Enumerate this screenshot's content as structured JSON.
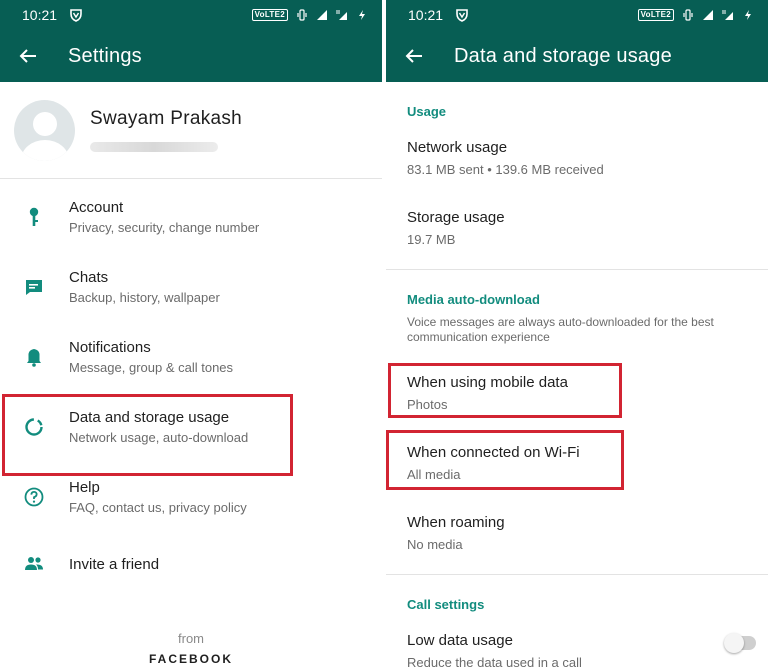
{
  "colors": {
    "brand": "#075e54",
    "accent": "#128c7e",
    "highlight": "#d22432"
  },
  "status_bar": {
    "time": "10:21",
    "volte_label": "VoLTE2"
  },
  "left": {
    "title": "Settings",
    "profile": {
      "name": "Swayam Prakash"
    },
    "items": [
      {
        "title": "Account",
        "subtitle": "Privacy, security, change number",
        "icon": "key-icon"
      },
      {
        "title": "Chats",
        "subtitle": "Backup, history, wallpaper",
        "icon": "chat-icon"
      },
      {
        "title": "Notifications",
        "subtitle": "Message, group & call tones",
        "icon": "bell-icon"
      },
      {
        "title": "Data and storage usage",
        "subtitle": "Network usage, auto-download",
        "icon": "data-usage-icon",
        "highlighted": true
      },
      {
        "title": "Help",
        "subtitle": "FAQ, contact us, privacy policy",
        "icon": "help-icon"
      },
      {
        "title": "Invite a friend",
        "subtitle": "",
        "icon": "people-icon"
      }
    ],
    "footer_from": "from",
    "footer_brand": "FACEBOOK"
  },
  "right": {
    "title": "Data and storage usage",
    "usage": {
      "header": "Usage",
      "network": {
        "title": "Network usage",
        "subtitle": "83.1 MB sent • 139.6 MB received"
      },
      "storage": {
        "title": "Storage usage",
        "subtitle": "19.7 MB"
      }
    },
    "media": {
      "header": "Media auto-download",
      "note": "Voice messages are always auto-downloaded for the best communication experience",
      "mobile": {
        "title": "When using mobile data",
        "subtitle": "Photos",
        "highlighted": true
      },
      "wifi": {
        "title": "When connected on Wi-Fi",
        "subtitle": "All media",
        "highlighted": true
      },
      "roaming": {
        "title": "When roaming",
        "subtitle": "No media"
      }
    },
    "calls": {
      "header": "Call settings",
      "low_data": {
        "title": "Low data usage",
        "subtitle": "Reduce the data used in a call",
        "enabled": false
      }
    }
  }
}
